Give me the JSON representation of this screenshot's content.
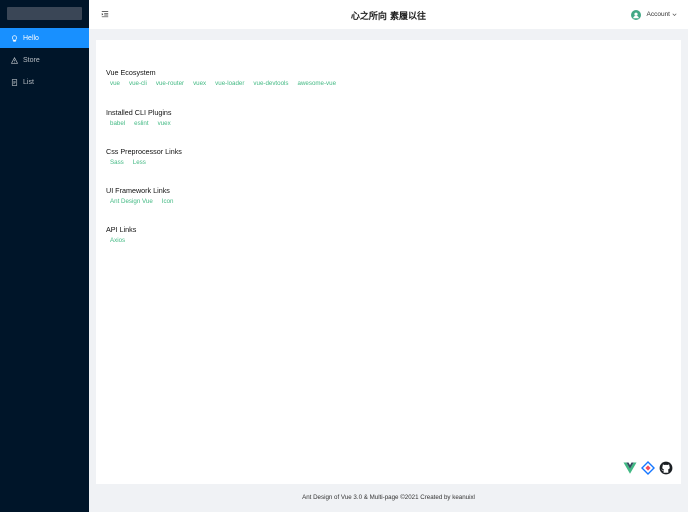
{
  "header": {
    "title": "心之所向 素履以往",
    "account_label": "Account"
  },
  "sidebar": {
    "items": [
      {
        "label": "Hello",
        "icon": "bulb-icon"
      },
      {
        "label": "Store",
        "icon": "warning-icon"
      },
      {
        "label": "List",
        "icon": "file-icon"
      }
    ]
  },
  "main": {
    "sections": [
      {
        "title": "Vue Ecosystem",
        "links": [
          "vue",
          "vue-cli",
          "vue-router",
          "vuex",
          "vue-loader",
          "vue-devtools",
          "awesome-vue"
        ]
      },
      {
        "title": "Installed CLI Plugins",
        "links": [
          "babel",
          "eslint",
          "vuex"
        ]
      },
      {
        "title": "Css Preprocessor Links",
        "links": [
          "Sass",
          "Less"
        ]
      },
      {
        "title": "UI Framework Links",
        "links": [
          "Ant Design Vue",
          "Icon"
        ]
      },
      {
        "title": "API Links",
        "links": [
          "Axios"
        ]
      }
    ]
  },
  "footer": {
    "text": "Ant Design of Vue 3.0 & Multi-page ©2021 Created by keanuixl"
  },
  "colors": {
    "sider": "#001529",
    "active": "#1890ff",
    "link": "#42b983",
    "background": "#f0f2f5"
  }
}
